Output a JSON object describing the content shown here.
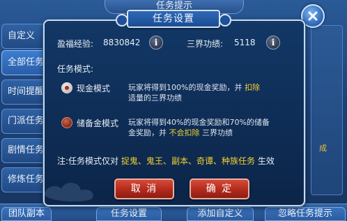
{
  "background": {
    "window_title": "任务提示",
    "side_tabs": [
      "自定义",
      "全部任务",
      "时间提醒",
      "门派任务",
      "剧情任务",
      "修炼任务"
    ],
    "active_tab_index": 1,
    "bottom_buttons": [
      "团队副本",
      "任务设置",
      "添加自定义",
      "忽略任务提示"
    ],
    "right_peek_text": "成"
  },
  "dialog": {
    "title": "任务设置",
    "stats": {
      "blessing_exp_label": "盈福经验:",
      "blessing_exp_value": "8830842",
      "merit_label": "三界功绩:",
      "merit_value": "5118",
      "info_icon_glyph": "i"
    },
    "mode_section_label": "任务模式:",
    "modes": [
      {
        "label": "现金模式",
        "selected": true,
        "desc_line1_a": "玩家将得到100%的现金奖励，并",
        "desc_line1_hl": "扣除",
        "desc_line2": "适量的三界功绩"
      },
      {
        "label": "储备金模式",
        "selected": false,
        "desc_line1": "玩家将得到40%的现金奖励和70%的储备",
        "desc_line2_a": "金奖励，并",
        "desc_line2_hl": "不会扣除",
        "desc_line2_b": "三界功绩"
      }
    ],
    "note": {
      "prefix": "注:任务模式仅对",
      "tasks": [
        "捉鬼",
        "鬼王",
        "副本",
        "奇谭",
        "种族任务"
      ],
      "separator": "、",
      "suffix": "生效"
    },
    "buttons": {
      "cancel": "取 消",
      "confirm": "确 定"
    }
  },
  "colors": {
    "highlight": "#f4d22f",
    "button_red": "#b22a1c",
    "dialog_bg": "#0e2c54",
    "panel_blue": "#2a5a98"
  }
}
